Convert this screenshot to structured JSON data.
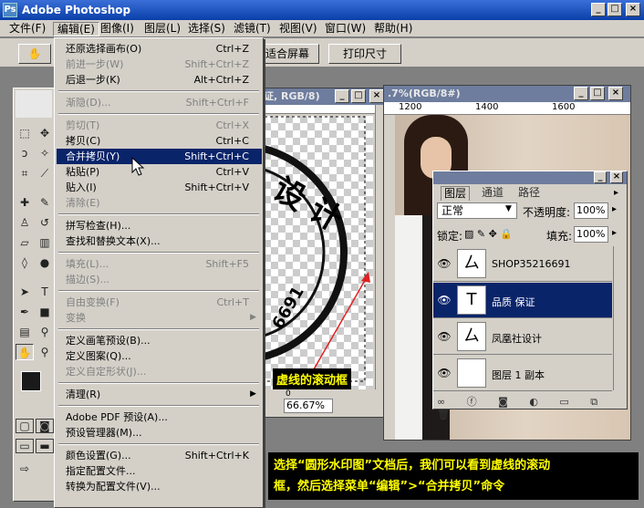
{
  "app": {
    "title": "Adobe Photoshop",
    "logo": "Ps"
  },
  "window_controls": {
    "minimize": "_",
    "maximize": "□",
    "close": "×"
  },
  "menubar": [
    "文件(F)",
    "编辑(E)",
    "图像(I)",
    "图层(L)",
    "选择(S)",
    "滤镜(T)",
    "视图(V)",
    "窗口(W)",
    "帮助(H)"
  ],
  "optionsbar": {
    "fit_screen": "适合屏幕",
    "print_size": "打印尺寸"
  },
  "edit_menu": [
    {
      "label": "还原选择画布(O)",
      "shortcut": "Ctrl+Z",
      "state": "normal"
    },
    {
      "label": "前进一步(W)",
      "shortcut": "Shift+Ctrl+Z",
      "state": "disabled"
    },
    {
      "label": "后退一步(K)",
      "shortcut": "Alt+Ctrl+Z",
      "state": "normal"
    },
    {
      "sep": true
    },
    {
      "label": "渐隐(D)...",
      "shortcut": "Shift+Ctrl+F",
      "state": "disabled"
    },
    {
      "sep": true
    },
    {
      "label": "剪切(T)",
      "shortcut": "Ctrl+X",
      "state": "disabled"
    },
    {
      "label": "拷贝(C)",
      "shortcut": "Ctrl+C",
      "state": "normal"
    },
    {
      "label": "合并拷贝(Y)",
      "shortcut": "Shift+Ctrl+C",
      "state": "highlight"
    },
    {
      "label": "粘贴(P)",
      "shortcut": "Ctrl+V",
      "state": "normal"
    },
    {
      "label": "贴入(I)",
      "shortcut": "Shift+Ctrl+V",
      "state": "normal"
    },
    {
      "label": "清除(E)",
      "shortcut": "",
      "state": "disabled"
    },
    {
      "sep": true
    },
    {
      "label": "拼写检查(H)...",
      "shortcut": "",
      "state": "normal"
    },
    {
      "label": "查找和替换文本(X)...",
      "shortcut": "",
      "state": "normal"
    },
    {
      "sep": true
    },
    {
      "label": "填充(L)...",
      "shortcut": "Shift+F5",
      "state": "disabled"
    },
    {
      "label": "描边(S)...",
      "shortcut": "",
      "state": "disabled"
    },
    {
      "sep": true
    },
    {
      "label": "自由变换(F)",
      "shortcut": "Ctrl+T",
      "state": "disabled"
    },
    {
      "label": "变换",
      "shortcut": "",
      "state": "disabled",
      "sub": true
    },
    {
      "sep": true
    },
    {
      "label": "定义画笔预设(B)...",
      "shortcut": "",
      "state": "normal"
    },
    {
      "label": "定义图案(Q)...",
      "shortcut": "",
      "state": "normal"
    },
    {
      "label": "定义自定形状(J)...",
      "shortcut": "",
      "state": "disabled"
    },
    {
      "sep": true
    },
    {
      "label": "清理(R)",
      "shortcut": "",
      "state": "normal",
      "sub": true
    },
    {
      "sep": true
    },
    {
      "label": "Adobe PDF 预设(A)...",
      "shortcut": "",
      "state": "normal"
    },
    {
      "label": "预设管理器(M)...",
      "shortcut": "",
      "state": "normal"
    },
    {
      "sep": true
    },
    {
      "label": "颜色设置(G)...",
      "shortcut": "Shift+Ctrl+K",
      "state": "normal"
    },
    {
      "label": "指定配置文件...",
      "shortcut": "",
      "state": "normal"
    },
    {
      "label": "转换为配置文件(V)...",
      "shortcut": "",
      "state": "normal"
    }
  ],
  "doc_left": {
    "title": "证, RGB/8)",
    "zoom": "66.67%",
    "ruler": "0"
  },
  "doc_right": {
    "title": ".7%(RGB/8#)",
    "ruler": [
      "1200",
      "1400",
      "1600"
    ]
  },
  "layers_panel": {
    "tabs": [
      "图层",
      "通道",
      "路径"
    ],
    "blend_mode": "正常",
    "opacity_label": "不透明度:",
    "opacity": "100%",
    "lock_label": "锁定:",
    "fill_label": "填充:",
    "fill": "100%",
    "layers": [
      {
        "name": "SHOP35216691",
        "thumb": "ㄙ",
        "selected": false
      },
      {
        "name": "品质 保证",
        "thumb": "T",
        "selected": true
      },
      {
        "name": "凤凰社设计",
        "thumb": "ㄙ",
        "selected": false
      },
      {
        "name": "图层 1 副本",
        "thumb": "",
        "selected": false
      }
    ]
  },
  "stamp_text": {
    "top": "设 计",
    "bottom": "6691"
  },
  "callouts": {
    "marquee": "虚线的滚动框",
    "instruction_1": "选择“圆形水印图”文档后，我们可以看到虚线的滚动",
    "instruction_2": "框，然后选择菜单“编辑”>“合并拷贝”命令"
  },
  "colors": {
    "title_blue": "#0a3fa8",
    "menu_highlight": "#0a246a",
    "callout_fg": "#ffff00",
    "doc_title": "#6e7d9e"
  }
}
